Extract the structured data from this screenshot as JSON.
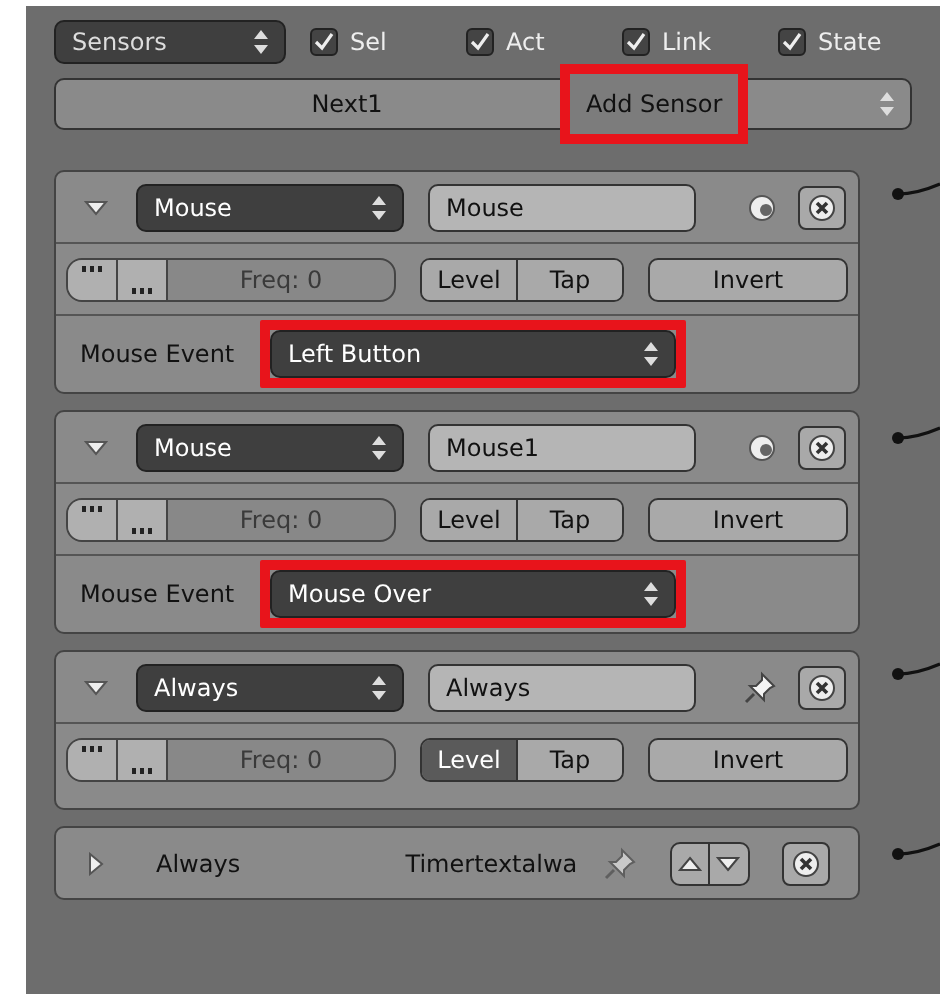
{
  "header": {
    "mode": "Sensors",
    "filters": [
      {
        "label": "Sel",
        "checked": true
      },
      {
        "label": "Act",
        "checked": true
      },
      {
        "label": "Link",
        "checked": true
      },
      {
        "label": "State",
        "checked": true
      }
    ]
  },
  "object_bar": {
    "object": "Next1",
    "add_menu": "Add Sensor",
    "highlighted": true
  },
  "sensors": [
    {
      "expanded": true,
      "type": "Mouse",
      "name": "Mouse",
      "kind": "eye",
      "freq": "Freq: 0",
      "level_label": "Level",
      "tap_label": "Tap",
      "level_on": false,
      "tap_on": false,
      "invert": "Invert",
      "event_label": "Mouse Event",
      "event": "Left Button",
      "event_highlighted": true
    },
    {
      "expanded": true,
      "type": "Mouse",
      "name": "Mouse1",
      "kind": "eye",
      "freq": "Freq: 0",
      "level_label": "Level",
      "tap_label": "Tap",
      "level_on": false,
      "tap_on": false,
      "invert": "Invert",
      "event_label": "Mouse Event",
      "event": "Mouse Over",
      "event_highlighted": true
    },
    {
      "expanded": true,
      "type": "Always",
      "name": "Always",
      "kind": "pin",
      "freq": "Freq: 0",
      "level_label": "Level",
      "tap_label": "Tap",
      "level_on": true,
      "tap_on": false,
      "invert": "Invert"
    },
    {
      "expanded": false,
      "type": "Always",
      "name": "Timertextalwa",
      "kind": "pin"
    }
  ]
}
